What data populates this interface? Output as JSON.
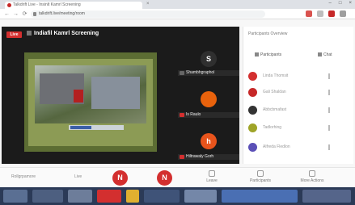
{
  "browser": {
    "tab_title": "Talkdrift Live - Insinlt Kamrl Screening",
    "tab_close": "×",
    "url": "talkdrift.live/meeting/room",
    "window_controls": [
      "–",
      "□",
      "×"
    ],
    "nav": {
      "back": "←",
      "forward": "→",
      "reload": "⟳"
    }
  },
  "stage": {
    "live_label": "Live",
    "title": "Indiafil Kamrl Screening",
    "participants": [
      {
        "initial": "S",
        "name": "Shambhgraphol",
        "color": "#2f2f2f"
      },
      {
        "initial": "",
        "name": "Is Raulo",
        "color": "#e8620c"
      },
      {
        "initial": "h",
        "name": "Hiltrawaly Gorh",
        "color": "#e8541c"
      }
    ]
  },
  "sidebar": {
    "title": "Participants Overview",
    "tabs": [
      {
        "label": "Participants",
        "active": true
      },
      {
        "label": "Chat",
        "active": false
      }
    ],
    "people": [
      {
        "name": "Linda Thomsit",
        "color": "#d32f2f"
      },
      {
        "name": "Gali Shaldan",
        "color": "#c62828"
      },
      {
        "name": "Abbcbmafast",
        "color": "#333333"
      },
      {
        "name": "Tadlorhing",
        "color": "#9fa428"
      },
      {
        "name": "Alfreda Fledlon",
        "color": "#5b50b7"
      }
    ]
  },
  "controls": {
    "left_text": "Rollgrpamore",
    "left_short": "Live",
    "mic_icon_label": "N",
    "cam_icon_label": "N",
    "items": [
      {
        "label": "Leave"
      },
      {
        "label": "Participants"
      },
      {
        "label": "More Actions"
      }
    ]
  },
  "colors": {
    "brand_red": "#d32f2f",
    "stage_bg": "#1b1b1b",
    "taskbar": "#2b3a57"
  }
}
